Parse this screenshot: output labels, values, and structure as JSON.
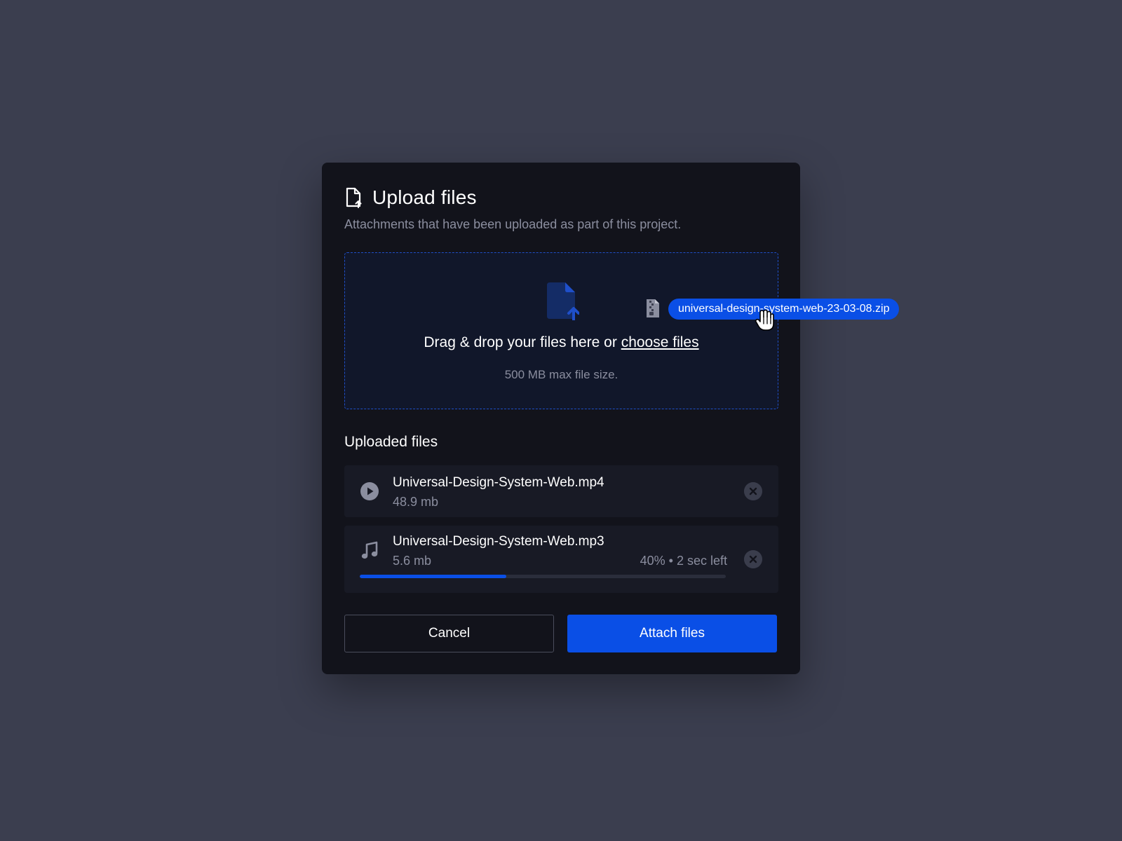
{
  "modal": {
    "title": "Upload files",
    "subtitle": "Attachments that have been uploaded as part of this project."
  },
  "dropzone": {
    "prompt": "Drag & drop your files here or ",
    "choose_link": "choose files",
    "hint": "500 MB max file size."
  },
  "dragging_file": {
    "name": "universal-design-system-web-23-03-08.zip",
    "icon": "zip-file-icon"
  },
  "uploaded": {
    "title": "Uploaded files",
    "files": [
      {
        "name": "Universal-Design-System-Web.mp4",
        "size": "48.9 mb",
        "icon": "play-icon",
        "status": "complete"
      },
      {
        "name": "Universal-Design-System-Web.mp3",
        "size": "5.6 mb",
        "icon": "music-note-icon",
        "status": "uploading",
        "progress_percent": 40,
        "progress_text": "40% • 2 sec left"
      }
    ]
  },
  "actions": {
    "cancel_label": "Cancel",
    "attach_label": "Attach files"
  },
  "colors": {
    "background": "#3b3e4f",
    "modal": "#12131b",
    "accent": "#0a4fe6",
    "muted_text": "#8b8e9f"
  }
}
